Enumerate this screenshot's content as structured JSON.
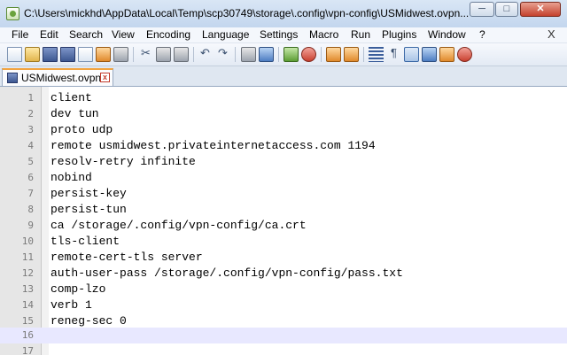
{
  "window": {
    "title": "C:\\Users\\mickhd\\AppData\\Local\\Temp\\scp30749\\storage\\.config\\vpn-config\\USMidwest.ovpn...",
    "min_glyph": "─",
    "max_glyph": "□",
    "close_glyph": "✕"
  },
  "menu": {
    "items": [
      "File",
      "Edit",
      "Search",
      "View",
      "Encoding",
      "Language",
      "Settings",
      "Macro",
      "Run",
      "Plugins",
      "Window",
      "?"
    ],
    "close_glyph": "X"
  },
  "tab": {
    "label": "USMidwest.ovpn",
    "close_glyph": "x"
  },
  "toolbar": {
    "icons": [
      "new-file-icon",
      "open-folder-icon",
      "save-icon",
      "save-all-icon",
      "close-icon",
      "close-all-icon",
      "print-icon",
      "cut-icon",
      "copy-icon",
      "paste-icon",
      "undo-icon",
      "redo-icon",
      "find-icon",
      "replace-icon",
      "zoom-in-icon",
      "zoom-out-icon",
      "sync-vertical-icon",
      "sync-horizontal-icon",
      "word-wrap-icon",
      "show-all-chars-icon",
      "indent-guide-icon",
      "doc-map-icon",
      "function-list-icon",
      "macro-record-icon"
    ]
  },
  "editor": {
    "current_line": 16,
    "lines": [
      {
        "n": "1",
        "text": "client"
      },
      {
        "n": "2",
        "text": "dev tun"
      },
      {
        "n": "3",
        "text": "proto udp"
      },
      {
        "n": "4",
        "text": "remote usmidwest.privateinternetaccess.com 1194"
      },
      {
        "n": "5",
        "text": "resolv-retry infinite"
      },
      {
        "n": "6",
        "text": "nobind"
      },
      {
        "n": "7",
        "text": "persist-key"
      },
      {
        "n": "8",
        "text": "persist-tun"
      },
      {
        "n": "9",
        "text": "ca /storage/.config/vpn-config/ca.crt"
      },
      {
        "n": "10",
        "text": "tls-client"
      },
      {
        "n": "11",
        "text": "remote-cert-tls server"
      },
      {
        "n": "12",
        "text": "auth-user-pass /storage/.config/vpn-config/pass.txt"
      },
      {
        "n": "13",
        "text": "comp-lzo"
      },
      {
        "n": "14",
        "text": "verb 1"
      },
      {
        "n": "15",
        "text": "reneg-sec 0"
      },
      {
        "n": "16",
        "text": ""
      },
      {
        "n": "17",
        "text": ""
      }
    ]
  }
}
